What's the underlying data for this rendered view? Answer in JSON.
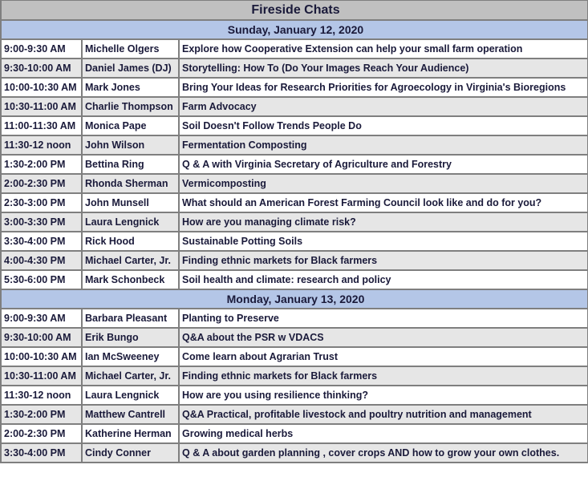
{
  "title": "Fireside Chats",
  "colors": {
    "title_bg": "#c0c0c0",
    "day_header_bg": "#b4c6e7",
    "row_alt_bg": "#e6e6e6",
    "row_bg": "#ffffff",
    "border": "#7f7f7f",
    "text": "#1a1a3a"
  },
  "days": [
    {
      "label": "Sunday, January 12, 2020",
      "sessions": [
        {
          "time": "9:00-9:30 AM",
          "speaker": "Michelle Olgers",
          "topic": "Explore how Cooperative Extension can help your small farm operation"
        },
        {
          "time": "9:30-10:00 AM",
          "speaker": "Daniel James (DJ)",
          "topic": "Storytelling: How To (Do Your Images Reach Your Audience)"
        },
        {
          "time": "10:00-10:30 AM",
          "speaker": "Mark Jones",
          "topic": "Bring Your Ideas for Research Priorities for Agroecology in Virginia's Bioregions"
        },
        {
          "time": "10:30-11:00 AM",
          "speaker": "Charlie Thompson",
          "topic": "Farm Advocacy"
        },
        {
          "time": "11:00-11:30 AM",
          "speaker": "Monica Pape",
          "topic": "Soil Doesn't Follow Trends People Do"
        },
        {
          "time": "11:30-12 noon",
          "speaker": "John Wilson",
          "topic": "Fermentation Composting"
        },
        {
          "time": "1:30-2:00 PM",
          "speaker": "Bettina Ring",
          "topic": "Q & A with Virginia Secretary of Agriculture and Forestry"
        },
        {
          "time": "2:00-2:30 PM",
          "speaker": "Rhonda Sherman",
          "topic": "Vermicomposting"
        },
        {
          "time": "2:30-3:00 PM",
          "speaker": "John Munsell",
          "topic": "What should an American Forest Farming Council look like and do for you?"
        },
        {
          "time": "3:00-3:30 PM",
          "speaker": "Laura Lengnick",
          "topic": "How are you managing climate risk?"
        },
        {
          "time": "3:30-4:00 PM",
          "speaker": "Rick Hood",
          "topic": "Sustainable Potting Soils"
        },
        {
          "time": "4:00-4:30 PM",
          "speaker": "Michael Carter, Jr.",
          "topic": "Finding ethnic markets for Black farmers"
        },
        {
          "time": "5:30-6:00 PM",
          "speaker": "Mark Schonbeck",
          "topic": "Soil health and climate: research and policy"
        }
      ]
    },
    {
      "label": "Monday, January 13, 2020",
      "sessions": [
        {
          "time": "9:00-9:30 AM",
          "speaker": "Barbara Pleasant",
          "topic": "Planting to Preserve"
        },
        {
          "time": "9:30-10:00 AM",
          "speaker": "Erik Bungo",
          "topic": "Q&A about the PSR w VDACS"
        },
        {
          "time": "10:00-10:30 AM",
          "speaker": "Ian McSweeney",
          "topic": "Come learn about Agrarian Trust"
        },
        {
          "time": "10:30-11:00 AM",
          "speaker": "Michael Carter, Jr.",
          "topic": "Finding ethnic markets for Black farmers"
        },
        {
          "time": "11:30-12 noon",
          "speaker": "Laura Lengnick",
          "topic": "How are you using resilience thinking?"
        },
        {
          "time": "1:30-2:00 PM",
          "speaker": "Matthew Cantrell",
          "topic": "Q&A Practical, profitable livestock and poultry nutrition and management"
        },
        {
          "time": "2:00-2:30 PM",
          "speaker": "Katherine Herman",
          "topic": "Growing medical herbs"
        },
        {
          "time": "3:30-4:00 PM",
          "speaker": "Cindy Conner",
          "topic": "Q & A about garden planning , cover crops AND how to grow your own clothes."
        }
      ]
    }
  ]
}
